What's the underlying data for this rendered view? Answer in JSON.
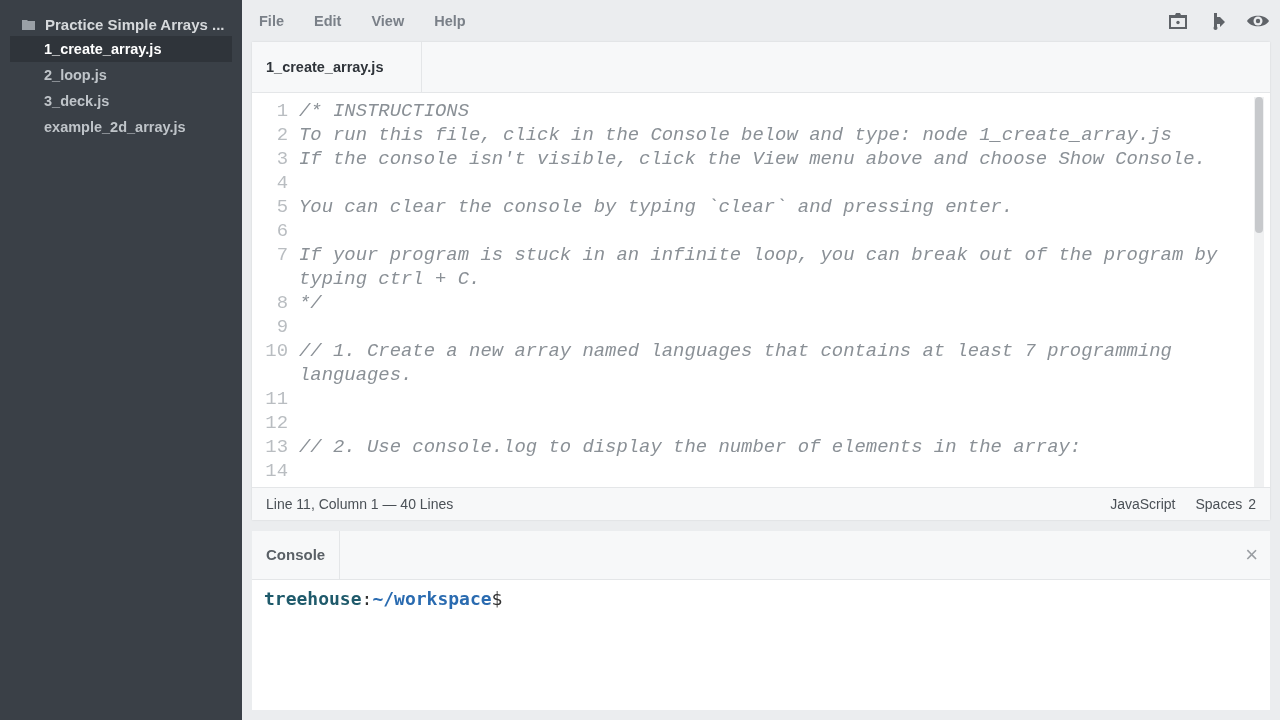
{
  "sidebar": {
    "folder": "Practice Simple Arrays ...",
    "files": [
      {
        "name": "1_create_array.js",
        "selected": true
      },
      {
        "name": "2_loop.js",
        "selected": false
      },
      {
        "name": "3_deck.js",
        "selected": false
      },
      {
        "name": "example_2d_array.js",
        "selected": false
      }
    ]
  },
  "menu": [
    "File",
    "Edit",
    "View",
    "Help"
  ],
  "editor": {
    "tab": "1_create_array.js",
    "lines": [
      {
        "number": "1",
        "text": "/* INSTRUCTIONS"
      },
      {
        "number": "2",
        "text": "To run this file, click in the Console below and type: node 1_create_array.js"
      },
      {
        "number": "3",
        "text": "If the console isn't visible, click the View menu above and choose Show Console."
      },
      {
        "number": "4"
      },
      {
        "number": "5",
        "text": "You can clear the console by typing `clear` and pressing enter."
      },
      {
        "number": "6"
      },
      {
        "number": "7",
        "text": "If your program is stuck in an infinite loop, you can break out of the program by typing ctrl + C."
      },
      {
        "number": "8",
        "text": "*/"
      },
      {
        "number": "9"
      },
      {
        "number": "10",
        "text": "// 1. Create a new array named languages that contains at least 7 programming languages."
      },
      {
        "number": "11"
      },
      {
        "number": "12"
      },
      {
        "number": "13",
        "text": "// 2. Use console.log to display the number of elements in the array:"
      },
      {
        "number": "14"
      }
    ],
    "status": "Line 11, Column 1 — 40 Lines",
    "language": "JavaScript",
    "indent": "Spaces",
    "indent_size": "2"
  },
  "console": {
    "tab": "Console",
    "close": "×",
    "user": "treehouse",
    "separator": ":",
    "path": "~/workspace",
    "prompt": "$"
  }
}
